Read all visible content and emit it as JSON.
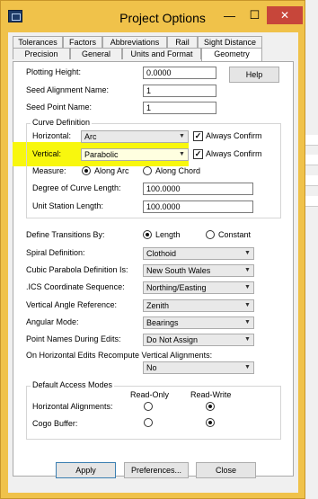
{
  "window": {
    "title": "Project Options",
    "minimize": "—",
    "maximize": "☐",
    "close": "✕"
  },
  "tabs": {
    "row1": [
      "Tolerances",
      "Factors",
      "Abbreviations",
      "Rail",
      "Sight Distance"
    ],
    "row2": [
      "Precision",
      "General",
      "Units and Format",
      "Geometry"
    ],
    "active": "Geometry"
  },
  "general": {
    "plotting_height_label": "Plotting Height:",
    "plotting_height_value": "0.0000",
    "help_label": "Help",
    "seed_alignment_label": "Seed Alignment Name:",
    "seed_alignment_value": "1",
    "seed_point_label": "Seed Point Name:",
    "seed_point_value": "1"
  },
  "curve_definition": {
    "legend": "Curve Definition",
    "horizontal_label": "Horizontal:",
    "horizontal_value": "Arc",
    "vertical_label": "Vertical:",
    "vertical_value": "Parabolic",
    "always_confirm_label": "Always Confirm",
    "measure_label": "Measure:",
    "along_arc": "Along Arc",
    "along_chord": "Along Chord",
    "degree_of_curve_label": "Degree of Curve Length:",
    "degree_of_curve_value": "100.0000",
    "unit_station_label": "Unit Station Length:",
    "unit_station_value": "100.0000"
  },
  "transitions": {
    "define_label": "Define Transitions By:",
    "length": "Length",
    "constant": "Constant",
    "spiral_label": "Spiral Definition:",
    "spiral_value": "Clothoid",
    "cubic_label": "Cubic Parabola Definition Is:",
    "cubic_value": "New South Wales",
    "ics_label": ".ICS Coordinate Sequence:",
    "ics_value": "Northing/Easting",
    "vertical_angle_label": "Vertical Angle Reference:",
    "vertical_angle_value": "Zenith",
    "angular_label": "Angular Mode:",
    "angular_value": "Bearings",
    "point_names_label": "Point Names During Edits:",
    "point_names_value": "Do Not Assign",
    "recompute_label": "On Horizontal Edits Recompute Vertical Alignments:",
    "recompute_value": "No"
  },
  "access_modes": {
    "legend": "Default Access Modes",
    "read_only": "Read-Only",
    "read_write": "Read-Write",
    "horizontal_label": "Horizontal Alignments:",
    "cogo_label": "Cogo Buffer:"
  },
  "footer": {
    "apply": "Apply",
    "preferences": "Preferences...",
    "close": "Close"
  },
  "colors": {
    "title_bar": "#f0c24a",
    "close_button": "#c7463a",
    "highlight": "#f8f70e"
  }
}
